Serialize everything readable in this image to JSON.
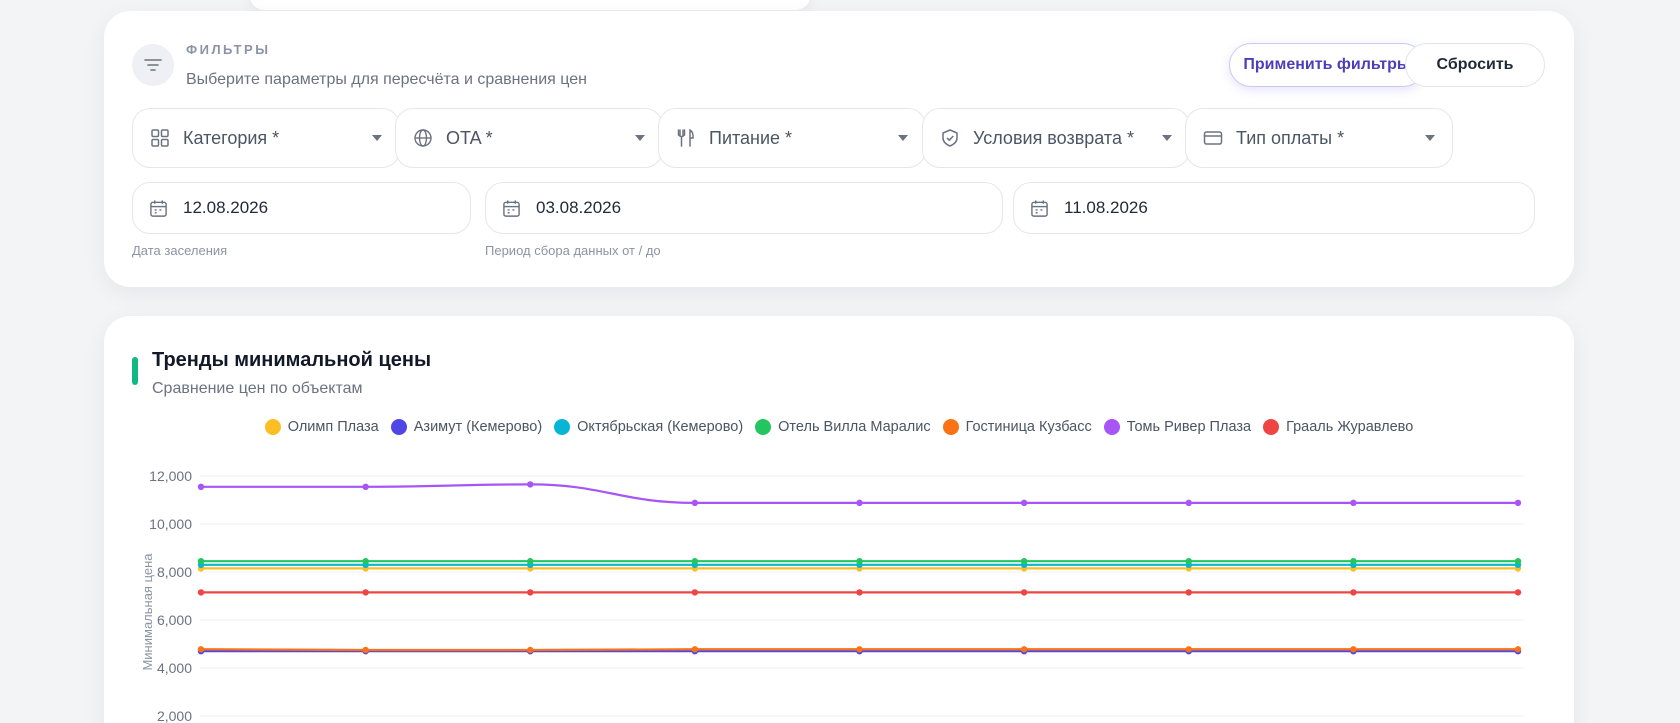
{
  "filters": {
    "title": "ФИЛЬТРЫ",
    "subtitle": "Выберите параметры для пересчёта и сравнения цен",
    "apply_label": "Применить фильтры",
    "reset_label": "Сбросить",
    "selects": [
      {
        "label": "Категория *",
        "icon": "grid-icon"
      },
      {
        "label": "OTA *",
        "icon": "globe-icon"
      },
      {
        "label": "Питание *",
        "icon": "fork-knife-icon"
      },
      {
        "label": "Условия возврата *",
        "icon": "shield-check-icon"
      },
      {
        "label": "Тип оплаты *",
        "icon": "credit-card-icon"
      }
    ],
    "checkin_date": "12.08.2026",
    "period_from": "03.08.2026",
    "period_to": "11.08.2026",
    "checkin_label": "Дата заселения",
    "period_label": "Период сбора данных от / до"
  },
  "chart_header": {
    "title": "Тренды минимальной цены",
    "subtitle": "Сравнение цен по объектам",
    "accent_color": "#10b981"
  },
  "chart_data": {
    "type": "line",
    "ylabel": "Минимальная цена",
    "yticks": [
      "12,000",
      "10,000",
      "8,000",
      "6,000",
      "4,000",
      "2,000"
    ],
    "ylim": [
      2000,
      12000
    ],
    "grid": true,
    "legend_position": "top-center",
    "points": 9,
    "series": [
      {
        "name": "Олимп Плаза",
        "color": "#fbbf24",
        "values": [
          8150,
          8150,
          8150,
          8150,
          8150,
          8150,
          8150,
          8150,
          8150
        ]
      },
      {
        "name": "Азимут (Кемерово)",
        "color": "#4f46e5",
        "values": [
          4700,
          4700,
          4700,
          4700,
          4700,
          4700,
          4700,
          4700,
          4700
        ]
      },
      {
        "name": "Октябрьская (Кемерово)",
        "color": "#06b6d4",
        "values": [
          8300,
          8300,
          8300,
          8300,
          8300,
          8300,
          8300,
          8300,
          8300
        ]
      },
      {
        "name": "Отель Вилла Маралис",
        "color": "#22c55e",
        "values": [
          8450,
          8450,
          8450,
          8450,
          8450,
          8450,
          8450,
          8450,
          8450
        ]
      },
      {
        "name": "Гостиница Кузбасс",
        "color": "#f97316",
        "values": [
          4780,
          4750,
          4750,
          4780,
          4780,
          4780,
          4780,
          4780,
          4780
        ]
      },
      {
        "name": "Томь Ривер Плаза",
        "color": "#a855f7",
        "values": [
          11550,
          11550,
          11650,
          10880,
          10880,
          10880,
          10880,
          10880,
          10880
        ]
      },
      {
        "name": "Грааль Журавлево",
        "color": "#ef4444",
        "values": [
          7150,
          7150,
          7150,
          7150,
          7150,
          7150,
          7150,
          7150,
          7150
        ]
      }
    ]
  }
}
